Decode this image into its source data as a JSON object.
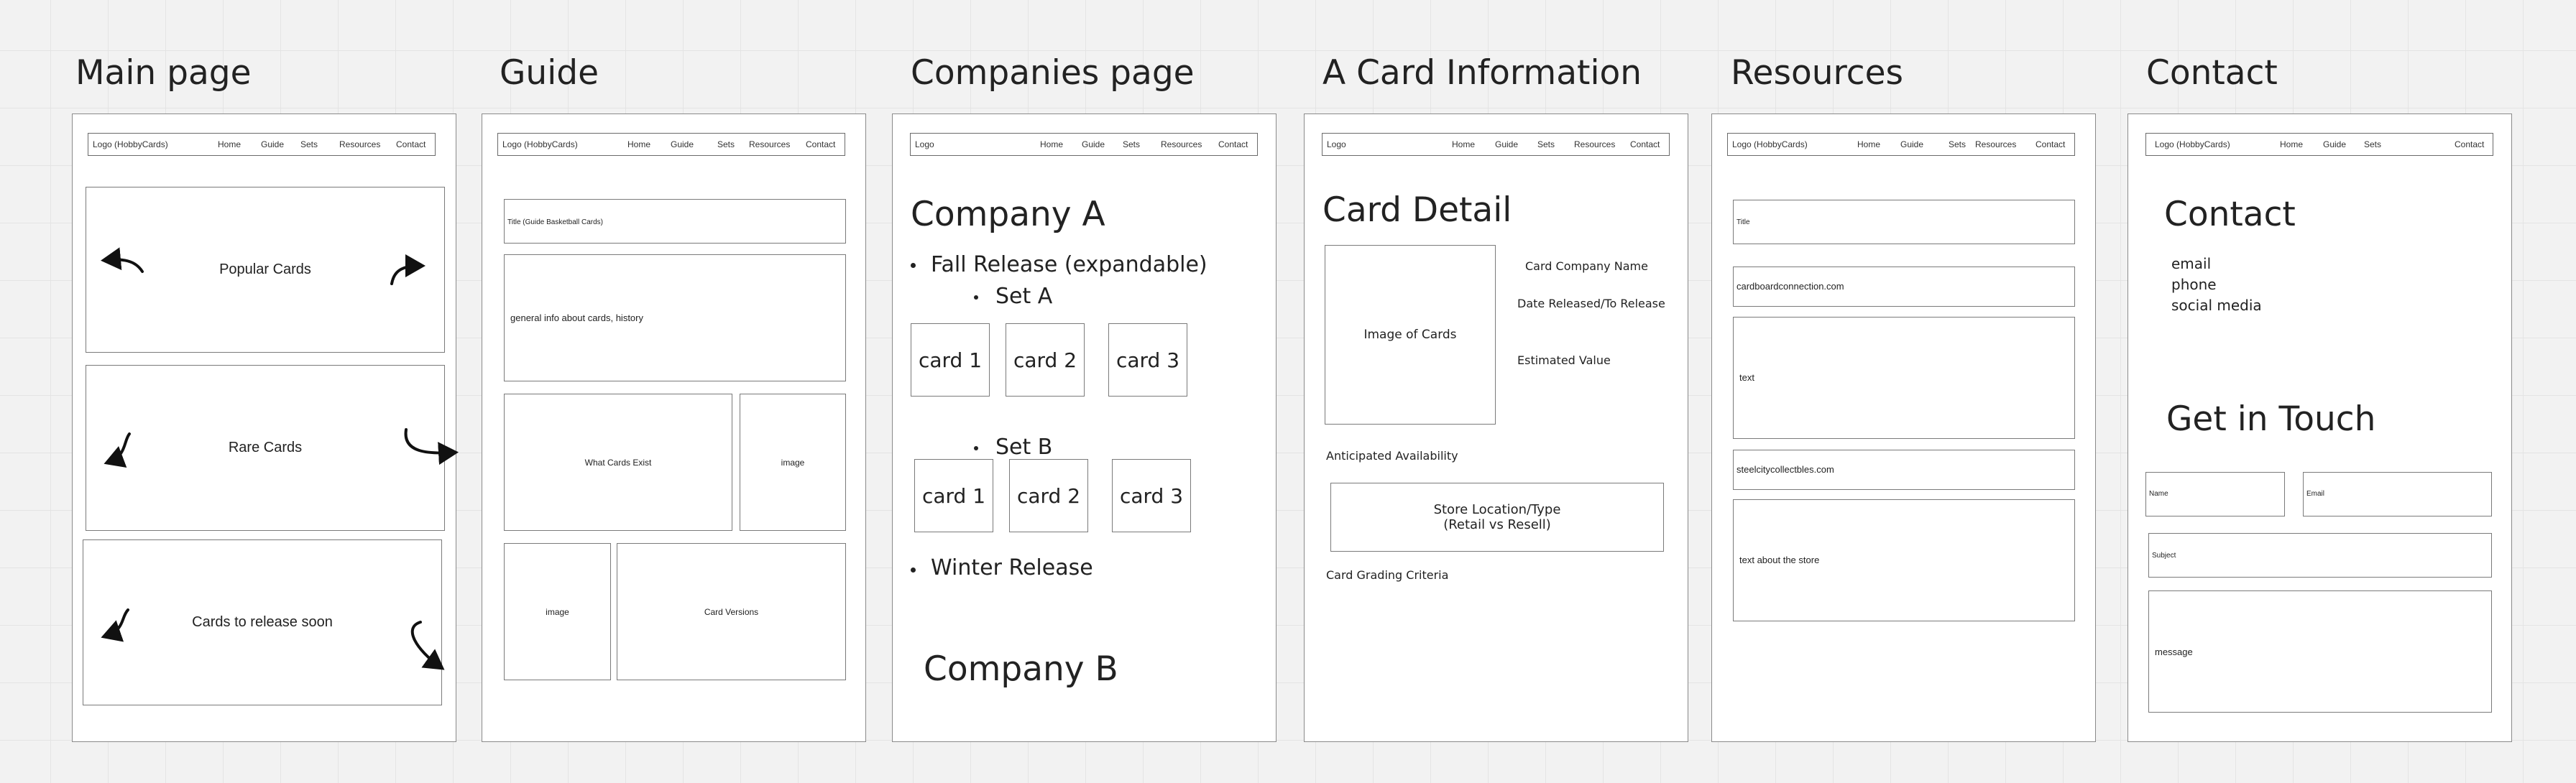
{
  "nav": {
    "logo_hobbycards": "Logo (HobbyCards)",
    "logo": "Logo",
    "home": "Home",
    "guide": "Guide",
    "sets": "Sets",
    "resources": "Resources",
    "contact": "Contact"
  },
  "main": {
    "title": "Main page",
    "popular": "Popular Cards",
    "rare": "Rare Cards",
    "release_soon": "Cards to release soon"
  },
  "guide": {
    "title": "Guide",
    "title_box": "Title (Guide Basketball Cards)",
    "general_info": "general info about cards, history",
    "what_cards_exist": "What Cards Exist",
    "image": "image",
    "card_versions": "Card Versions"
  },
  "companies": {
    "title": "Companies page",
    "company_a": "Company A",
    "fall_release": "Fall Release (expandable)",
    "set_a": "Set A",
    "set_b": "Set B",
    "card1": "card 1",
    "card2": "card 2",
    "card3": "card 3",
    "winter_release": "Winter Release",
    "company_b": "Company B"
  },
  "card_info": {
    "title": "A Card Information",
    "heading": "Card Detail",
    "image_of_cards": "Image of Cards",
    "company_name": "Card Company Name",
    "date_released": "Date Released/To Release",
    "estimated_value": "Estimated Value",
    "anticipated": "Anticipated Availability",
    "store_location": "Store Location/Type",
    "retail_vs_resell": "(Retail vs Resell)",
    "grading": "Card Grading Criteria"
  },
  "resources": {
    "title": "Resources",
    "title_box": "Title",
    "link1": "cardboardconnection.com",
    "text": "text",
    "link2": "steelcitycollectbles.com",
    "store_text": "text about the store"
  },
  "contact": {
    "title": "Contact",
    "heading": "Contact",
    "email": "email",
    "phone": "phone",
    "social": "social media",
    "get_in_touch": "Get in Touch",
    "name": "Name",
    "email_field": "Email",
    "subject": "Subject",
    "message": "message"
  }
}
